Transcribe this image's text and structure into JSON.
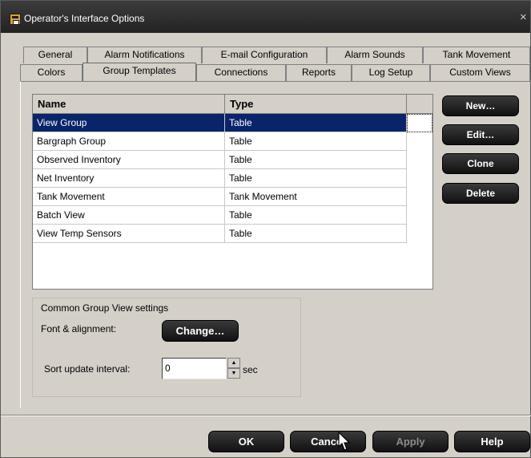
{
  "window": {
    "title": "Operator's Interface Options",
    "close_symbol": "×"
  },
  "tabs": {
    "row_top": [
      "General",
      "Alarm Notifications",
      "E-mail Configuration",
      "Alarm Sounds",
      "Tank Movement"
    ],
    "row_bottom": [
      "Colors",
      "Group Templates",
      "Connections",
      "Reports",
      "Log Setup",
      "Custom Views"
    ],
    "active": "Group Templates"
  },
  "grid": {
    "headers": [
      "Name",
      "Type"
    ],
    "rows": [
      {
        "name": "View Group",
        "type": "Table"
      },
      {
        "name": "Bargraph Group",
        "type": "Table"
      },
      {
        "name": "Observed Inventory",
        "type": "Table"
      },
      {
        "name": "Net Inventory",
        "type": "Table"
      },
      {
        "name": "Tank Movement",
        "type": "Tank Movement"
      },
      {
        "name": "Batch View",
        "type": "Table"
      },
      {
        "name": "View Temp Sensors",
        "type": "Table"
      }
    ],
    "selected_row": "View Group"
  },
  "side_buttons": {
    "new": "New…",
    "edit": "Edit…",
    "clone": "Clone",
    "delete": "Delete"
  },
  "settings": {
    "group_label": "Common Group View settings",
    "font_label": "Font & alignment:",
    "change_label": "Change…",
    "sort_label": "Sort update interval:",
    "sort_value": "0",
    "sort_unit": "sec"
  },
  "footer": {
    "ok": "OK",
    "cancel": "Cancel",
    "apply": "Apply",
    "help": "Help"
  },
  "colors": {
    "selection": "#0a246a",
    "titlebar": "#2b2b2b",
    "dialog": "#d4d0c8",
    "button": "#1a1a1a"
  }
}
